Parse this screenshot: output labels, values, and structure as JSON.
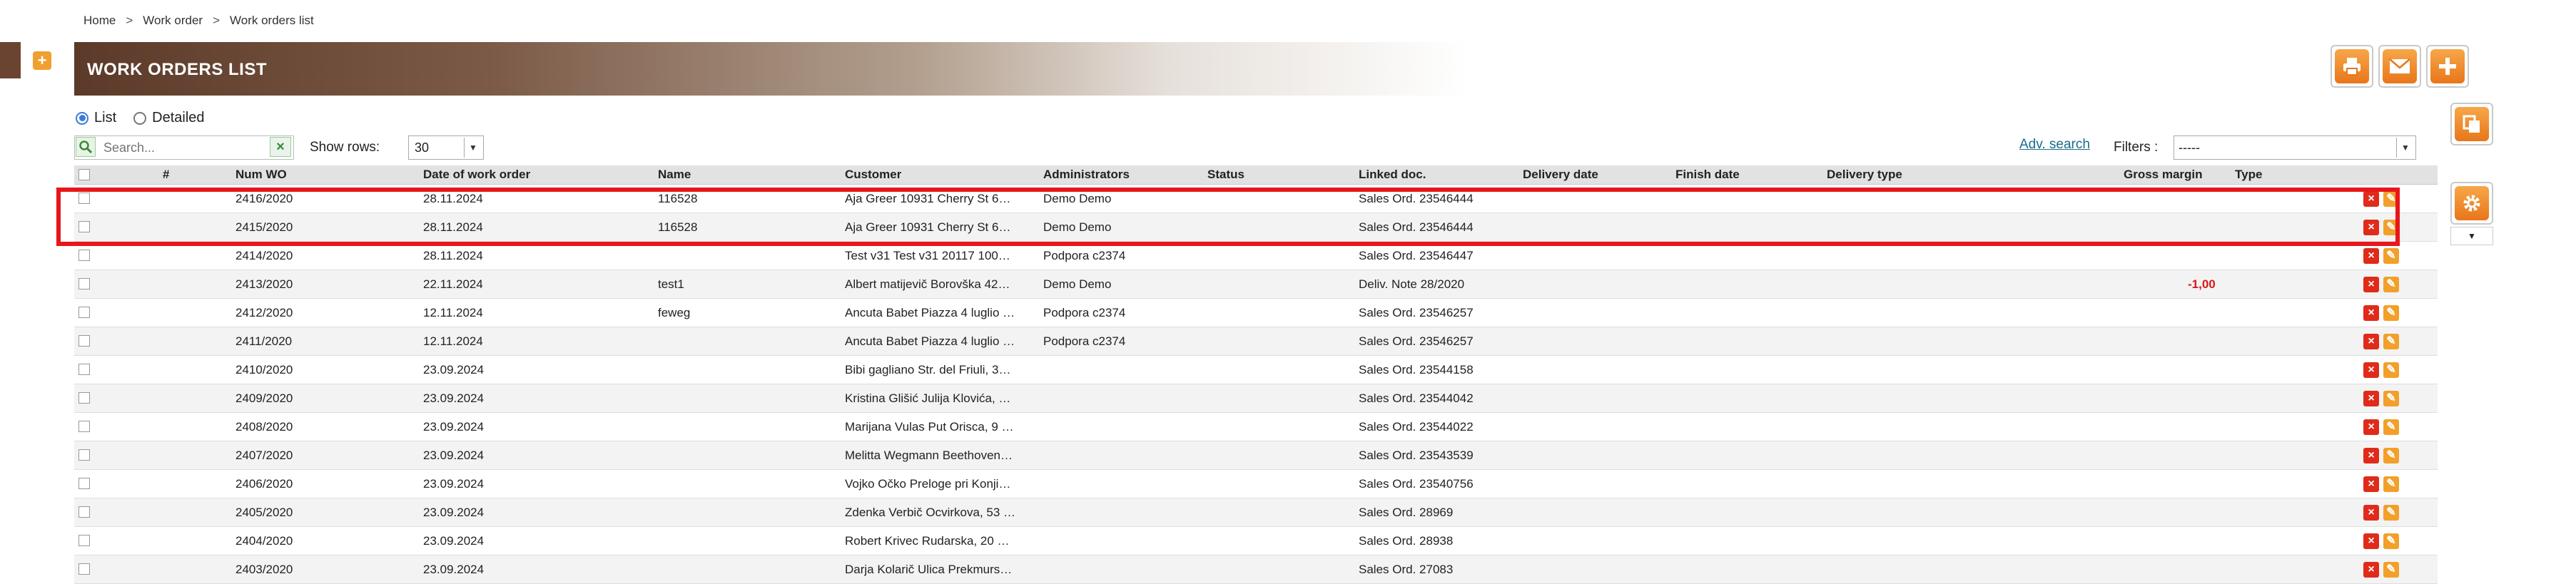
{
  "breadcrumb": {
    "home": "Home",
    "sep": ">",
    "work_order": "Work order",
    "current": "Work orders list"
  },
  "header": {
    "title": "WORK ORDERS LIST"
  },
  "view": {
    "list_label": "List",
    "detailed_label": "Detailed",
    "selected": "List"
  },
  "search": {
    "placeholder": "Search...",
    "value": ""
  },
  "show_rows": {
    "label": "Show rows:",
    "value": "30"
  },
  "adv_search": "Adv. search",
  "filters": {
    "label": "Filters :",
    "value": "-----"
  },
  "table": {
    "headers": [
      "#",
      "Num WO",
      "Date of work order",
      "Name",
      "Customer",
      "Administrators",
      "Status",
      "Linked doc.",
      "Delivery date",
      "Finish date",
      "Delivery type",
      "Gross margin",
      "Type"
    ],
    "rows": [
      {
        "num": "2416/2020",
        "date": "28.11.2024",
        "name": "116528",
        "customer": "Aja Greer 10931 Cherry St 6…",
        "admin": "Demo Demo",
        "status": "",
        "linked": "Sales Ord. 23546444",
        "delivery": "",
        "finish": "",
        "dtype": "",
        "margin": "",
        "type": ""
      },
      {
        "num": "2415/2020",
        "date": "28.11.2024",
        "name": "116528",
        "customer": "Aja Greer 10931 Cherry St 6…",
        "admin": "Demo Demo",
        "status": "",
        "linked": "Sales Ord. 23546444",
        "delivery": "",
        "finish": "",
        "dtype": "",
        "margin": "",
        "type": ""
      },
      {
        "num": "2414/2020",
        "date": "28.11.2024",
        "name": "",
        "customer": "Test v31 Test v31 20117 100…",
        "admin": "Podpora c2374",
        "status": "",
        "linked": "Sales Ord. 23546447",
        "delivery": "",
        "finish": "",
        "dtype": "",
        "margin": "",
        "type": ""
      },
      {
        "num": "2413/2020",
        "date": "22.11.2024",
        "name": "test1",
        "customer": "Albert matijevič Borovška 42…",
        "admin": "Demo Demo",
        "status": "",
        "linked": "Deliv. Note 28/2020",
        "delivery": "",
        "finish": "",
        "dtype": "",
        "margin": "-1,00",
        "type": ""
      },
      {
        "num": "2412/2020",
        "date": "12.11.2024",
        "name": "feweg",
        "customer": "Ancuta Babet Piazza 4 luglio …",
        "admin": "Podpora c2374",
        "status": "",
        "linked": "Sales Ord. 23546257",
        "delivery": "",
        "finish": "",
        "dtype": "",
        "margin": "",
        "type": ""
      },
      {
        "num": "2411/2020",
        "date": "12.11.2024",
        "name": "",
        "customer": "Ancuta Babet Piazza 4 luglio …",
        "admin": "Podpora c2374",
        "status": "",
        "linked": "Sales Ord. 23546257",
        "delivery": "",
        "finish": "",
        "dtype": "",
        "margin": "",
        "type": ""
      },
      {
        "num": "2410/2020",
        "date": "23.09.2024",
        "name": "",
        "customer": "Bibi gagliano Str. del Friuli, 3…",
        "admin": "",
        "status": "",
        "linked": "Sales Ord. 23544158",
        "delivery": "",
        "finish": "",
        "dtype": "",
        "margin": "",
        "type": ""
      },
      {
        "num": "2409/2020",
        "date": "23.09.2024",
        "name": "",
        "customer": "Kristina Glišić Julija Klovića, …",
        "admin": "",
        "status": "",
        "linked": "Sales Ord. 23544042",
        "delivery": "",
        "finish": "",
        "dtype": "",
        "margin": "",
        "type": ""
      },
      {
        "num": "2408/2020",
        "date": "23.09.2024",
        "name": "",
        "customer": "Marijana Vulas Put Orisca, 9 …",
        "admin": "",
        "status": "",
        "linked": "Sales Ord. 23544022",
        "delivery": "",
        "finish": "",
        "dtype": "",
        "margin": "",
        "type": ""
      },
      {
        "num": "2407/2020",
        "date": "23.09.2024",
        "name": "",
        "customer": "Melitta Wegmann Beethoven…",
        "admin": "",
        "status": "",
        "linked": "Sales Ord. 23543539",
        "delivery": "",
        "finish": "",
        "dtype": "",
        "margin": "",
        "type": ""
      },
      {
        "num": "2406/2020",
        "date": "23.09.2024",
        "name": "",
        "customer": "Vojko Očko Preloge pri Konji…",
        "admin": "",
        "status": "",
        "linked": "Sales Ord. 23540756",
        "delivery": "",
        "finish": "",
        "dtype": "",
        "margin": "",
        "type": ""
      },
      {
        "num": "2405/2020",
        "date": "23.09.2024",
        "name": "",
        "customer": "Zdenka Verbič Ocvirkova, 53 …",
        "admin": "",
        "status": "",
        "linked": "Sales Ord. 28969",
        "delivery": "",
        "finish": "",
        "dtype": "",
        "margin": "",
        "type": ""
      },
      {
        "num": "2404/2020",
        "date": "23.09.2024",
        "name": "",
        "customer": "Robert Krivec Rudarska, 20 …",
        "admin": "",
        "status": "",
        "linked": "Sales Ord. 28938",
        "delivery": "",
        "finish": "",
        "dtype": "",
        "margin": "",
        "type": ""
      },
      {
        "num": "2403/2020",
        "date": "23.09.2024",
        "name": "",
        "customer": "Darja Kolarič Ulica Prekmurs…",
        "admin": "",
        "status": "",
        "linked": "Sales Ord. 27083",
        "delivery": "",
        "finish": "",
        "dtype": "",
        "margin": "",
        "type": ""
      }
    ]
  },
  "icons": {
    "print": "printer-icon",
    "email": "envelope-icon",
    "add": "plus-icon",
    "copy": "copy-icon",
    "settings": "gear-icon",
    "delete": "delete-icon",
    "edit": "pencil-icon"
  },
  "colors": {
    "accent": "#f0902a",
    "header_dark": "#5c3a29",
    "highlight": "#e8161a",
    "negative": "#d81818"
  }
}
